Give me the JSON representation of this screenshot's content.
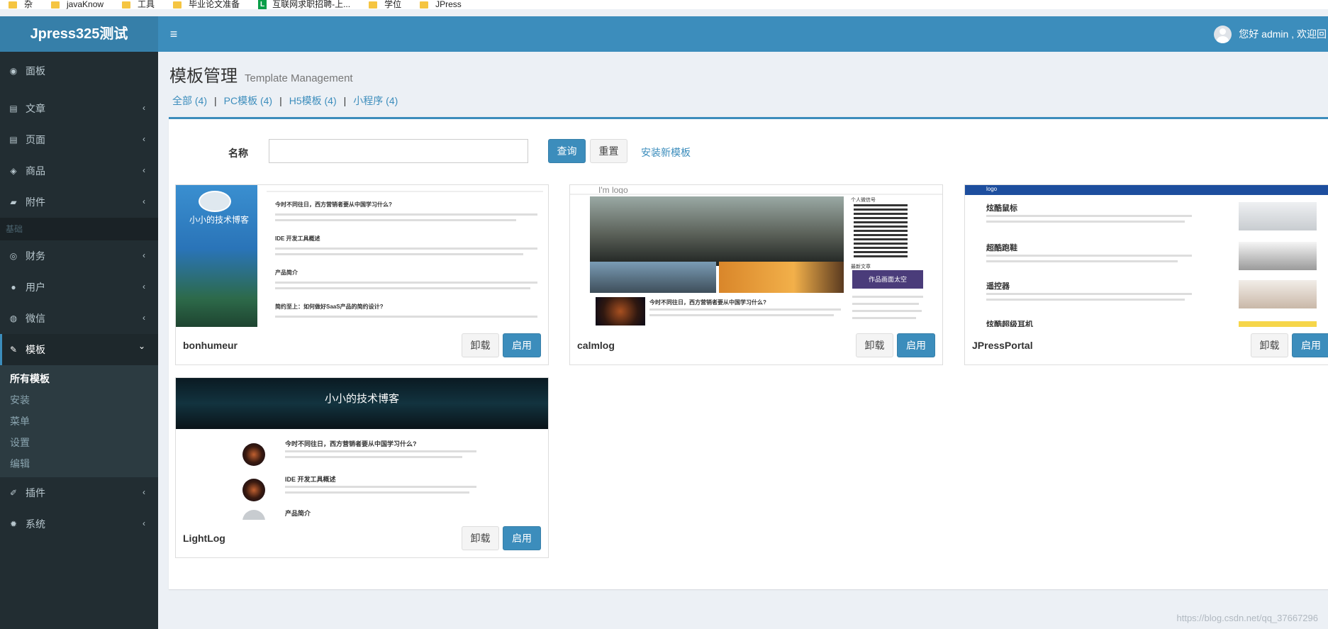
{
  "bookmarks": [
    {
      "label": "杂",
      "icon": "folder-icon"
    },
    {
      "label": "javaKnow",
      "icon": "folder-icon"
    },
    {
      "label": "工具",
      "icon": "folder-icon"
    },
    {
      "label": "毕业论文准备",
      "icon": "folder-icon"
    },
    {
      "label": "互联网求职招聘-上...",
      "icon": "lagou-icon",
      "badge": "L"
    },
    {
      "label": "学位",
      "icon": "folder-icon"
    },
    {
      "label": "JPress",
      "icon": "folder-icon"
    }
  ],
  "header": {
    "logo": "Jpress325测试",
    "toggle": "≡",
    "user_text": "您好 admin , 欢迎回"
  },
  "sidebar": {
    "items": [
      {
        "label": "面板",
        "icon": "dashboard-icon",
        "glyph": "◉"
      },
      {
        "label": "文章",
        "icon": "file-icon",
        "glyph": "▤"
      },
      {
        "label": "页面",
        "icon": "file-icon",
        "glyph": "▤"
      },
      {
        "label": "商品",
        "icon": "tags-icon",
        "glyph": "◈"
      },
      {
        "label": "附件",
        "icon": "folder-icon",
        "glyph": "▰"
      }
    ],
    "section_header": "基础",
    "items2": [
      {
        "label": "财务",
        "icon": "money-icon",
        "glyph": "◎"
      },
      {
        "label": "用户",
        "icon": "user-icon",
        "glyph": "●"
      },
      {
        "label": "微信",
        "icon": "wechat-icon",
        "glyph": "◍"
      },
      {
        "label": "模板",
        "icon": "magic-icon",
        "glyph": "✎"
      }
    ],
    "submenu": [
      "所有模板",
      "安装",
      "菜单",
      "设置",
      "编辑"
    ],
    "items3": [
      {
        "label": "插件",
        "icon": "plug-icon",
        "glyph": "✐"
      },
      {
        "label": "系统",
        "icon": "gear-icon",
        "glyph": "✹"
      }
    ],
    "chevron_left": "‹",
    "chevron_down": "⌄"
  },
  "page": {
    "title": "模板管理",
    "subtitle": "Template Management"
  },
  "filters": [
    {
      "label": "全部 (4)"
    },
    {
      "label": "PC模板 (4)"
    },
    {
      "label": "H5模板 (4)"
    },
    {
      "label": "小程序 (4)"
    }
  ],
  "filter_separator": "|",
  "search": {
    "label": "名称",
    "value": "",
    "query_button": "查询",
    "reset_button": "重置",
    "install_link": "安装新模板"
  },
  "templates": [
    {
      "name": "bonhumeur",
      "uninstall": "卸载",
      "enable": "启用",
      "thumb_text": "小小的技术博客"
    },
    {
      "name": "calmlog",
      "uninstall": "卸载",
      "enable": "启用",
      "thumb_text": "I'm logo"
    },
    {
      "name": "JPressPortal",
      "uninstall": "卸载",
      "enable": "启用",
      "thumb_text": "logo"
    },
    {
      "name": "LightLog",
      "uninstall": "卸载",
      "enable": "启用",
      "thumb_text": "小小的技术博客"
    }
  ],
  "thumb_texts": {
    "bonhumeur_posts": [
      "今时不同往日，西方营销者要从中国学习什么?",
      "IDE 开发工具概述",
      "产品简介",
      "简约至上：如何做好SaaS产品的简约设计?"
    ],
    "calmlog_side": [
      "个人微信号",
      "最新文章",
      "作品画面太空"
    ],
    "calmlog_post": "今时不同往日，西方营销者要从中国学习什么?",
    "portal_posts": [
      "炫酷鼠标",
      "超酷跑鞋",
      "遥控器",
      "炫酷超级耳机"
    ],
    "lightlog_posts": [
      "今时不同往日，西方营销者要从中国学习什么?",
      "IDE 开发工具概述",
      "产品简介"
    ]
  },
  "watermark": "https://blog.csdn.net/qq_37667296"
}
